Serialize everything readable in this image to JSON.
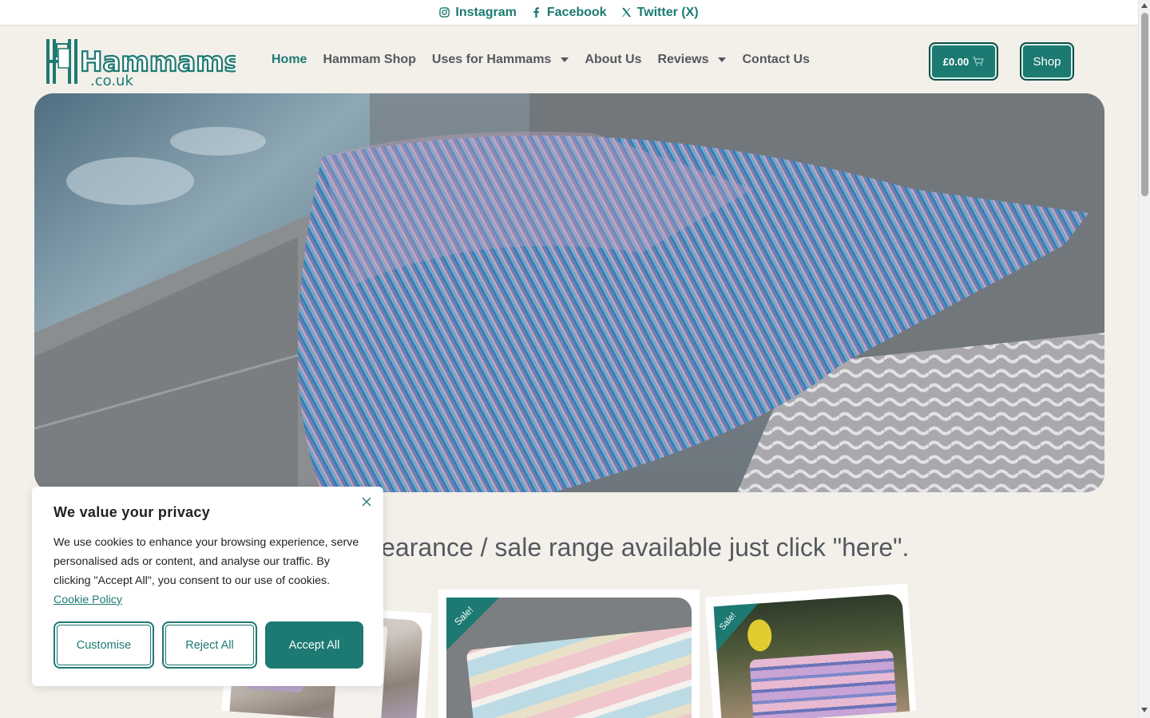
{
  "topbar": {
    "social": [
      {
        "label": "Instagram",
        "icon": "instagram-icon"
      },
      {
        "label": "Facebook",
        "icon": "facebook-icon"
      },
      {
        "label": "Twitter (X)",
        "icon": "x-twitter-icon"
      }
    ]
  },
  "logo": {
    "main": "Hammams",
    "sub": ".co.uk"
  },
  "nav": {
    "items": [
      {
        "label": "Home",
        "active": true,
        "dropdown": false
      },
      {
        "label": "Hammam Shop",
        "active": false,
        "dropdown": false
      },
      {
        "label": "Uses for Hammams",
        "active": false,
        "dropdown": true
      },
      {
        "label": "About Us",
        "active": false,
        "dropdown": false
      },
      {
        "label": "Reviews",
        "active": false,
        "dropdown": true
      },
      {
        "label": "Contact Us",
        "active": false,
        "dropdown": false
      }
    ]
  },
  "header": {
    "cart_total": "£0.00",
    "shop_label": "Shop"
  },
  "main": {
    "headline": "learance / sale range available just click \"here\"."
  },
  "products": [
    {
      "badge": ""
    },
    {
      "badge": "Sale!"
    },
    {
      "badge": "Sale!"
    }
  ],
  "cookie": {
    "title": "We value your privacy",
    "body": "We use cookies to enhance your browsing experience, serve personalised ads or content, and analyse our traffic. By clicking \"Accept All\", you consent to our use of cookies.",
    "policy_link": "Cookie Policy",
    "customise": "Customise",
    "reject": "Reject All",
    "accept": "Accept All"
  },
  "colors": {
    "brand": "#1c7a72",
    "background": "#f3efe9",
    "text": "#54595f"
  }
}
